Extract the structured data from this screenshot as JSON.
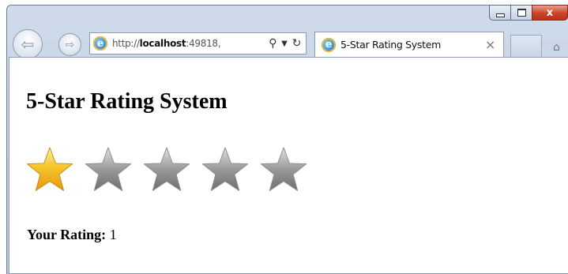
{
  "browser": {
    "address": {
      "prefix": "http://",
      "host": "localhost",
      "rest": ":49818,"
    },
    "tab": {
      "title": "5-Star Rating System",
      "close_glyph": "×"
    },
    "caption_close_glyph": "x"
  },
  "page": {
    "title": "5-Star Rating System",
    "rating_label": "Your Rating:",
    "rating_value": "1"
  },
  "rating": {
    "value": 1,
    "max": 5,
    "filled_color": "#f6c52a",
    "empty_color": "#9a9a9a"
  },
  "icons": {
    "back": "back-arrow-icon",
    "forward": "forward-arrow-icon",
    "site": "ie-icon",
    "search": "search-icon",
    "refresh": "refresh-icon",
    "home": "home-icon"
  }
}
